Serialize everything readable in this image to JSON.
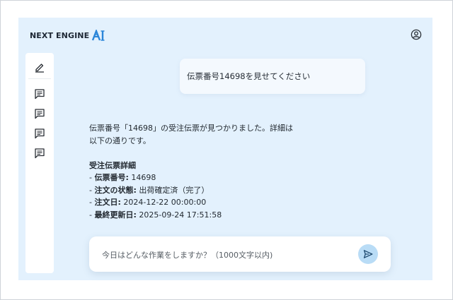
{
  "header": {
    "logo_text": "NEXT ENGINE",
    "logo_ai": "AI"
  },
  "sidebar": {
    "items": [
      {
        "icon": "pencil-icon"
      },
      {
        "icon": "chat-icon"
      },
      {
        "icon": "chat-icon"
      },
      {
        "icon": "chat-icon"
      },
      {
        "icon": "chat-icon"
      }
    ]
  },
  "chat": {
    "user_message": "伝票番号14698を見せてください",
    "bot": {
      "intro_line1": "伝票番号「14698」の受注伝票が見つかりました。詳細は",
      "intro_line2": "以下の通りです。",
      "section_title": "受注伝票詳細",
      "fields": [
        {
          "label": "伝票番号:",
          "value": "14698"
        },
        {
          "label": "注文の状態:",
          "value": "出荷確定済（完了）"
        },
        {
          "label": "注文日:",
          "value": "2024-12-22 00:00:00"
        },
        {
          "label": "最終更新日:",
          "value": "2025-09-24 17:51:58"
        }
      ]
    }
  },
  "composer": {
    "placeholder": "今日はどんな作業をしますか？（1000文字以内)",
    "value": ""
  },
  "colors": {
    "background": "#e3f1fd",
    "accent": "#b9dcf6",
    "logo_blue": "#2b86d9"
  }
}
